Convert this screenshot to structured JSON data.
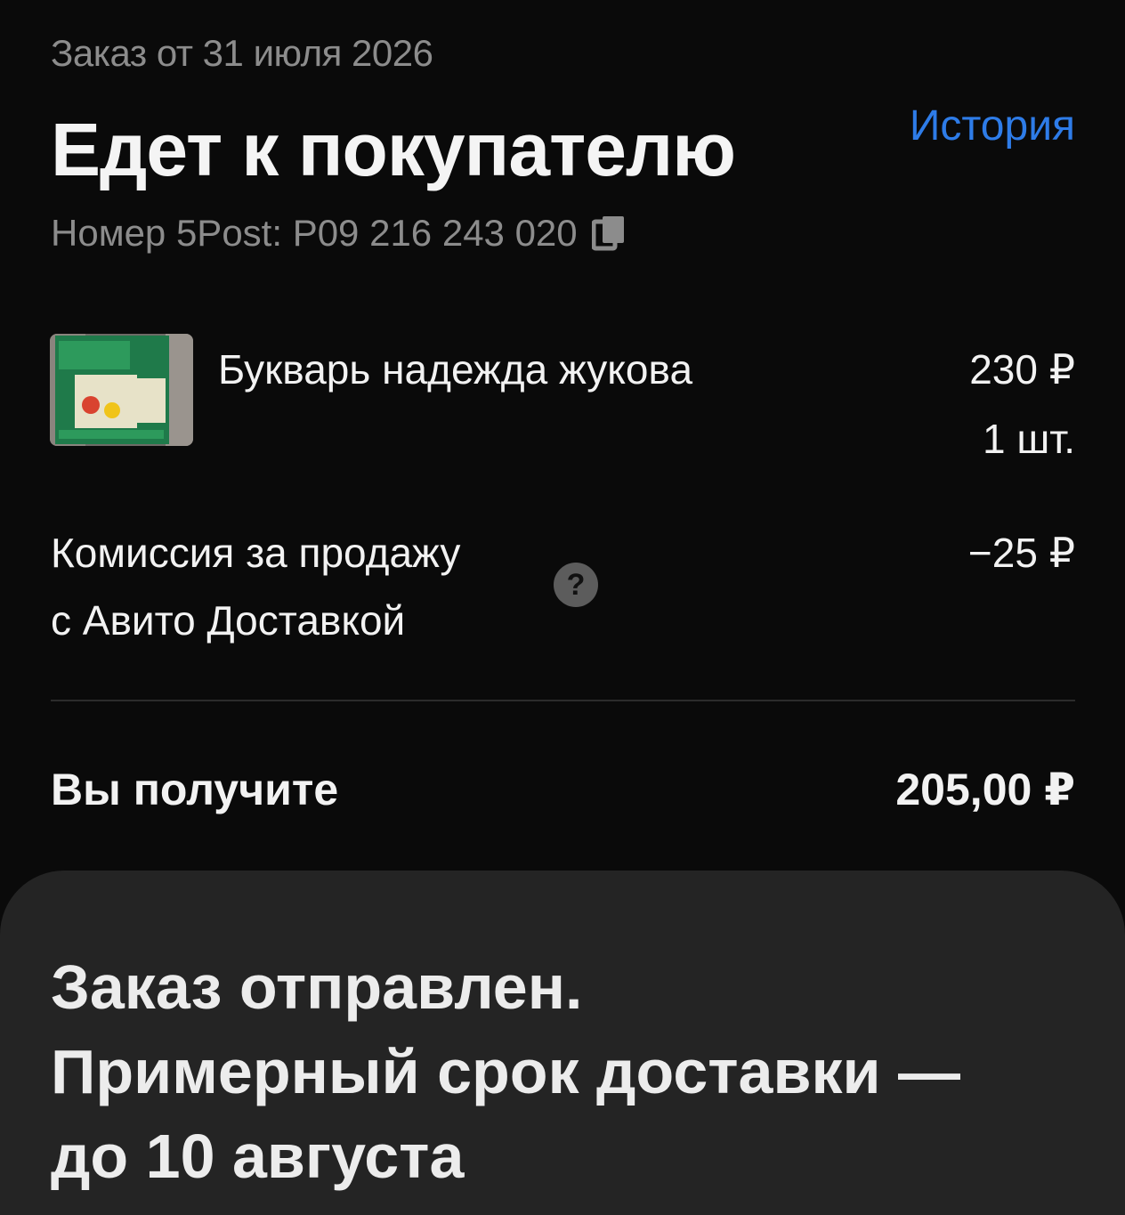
{
  "order": {
    "date_label": "Заказ от 31 июля 2026",
    "status_title": "Едет к покупателю",
    "history_link": "История",
    "tracking_label": "Номер 5Post: P09 216 243 020"
  },
  "item": {
    "thumbnail_icon": "book-cover-image",
    "name": "Букварь надежда жукова",
    "price": "230 ₽",
    "quantity": "1 шт."
  },
  "fee": {
    "label_line1": "Комиссия за продажу",
    "label_line2": "с Авито Доставкой",
    "help_glyph": "?",
    "amount": "−25 ₽"
  },
  "payout": {
    "label": "Вы получите",
    "amount": "205,00 ₽"
  },
  "notice": {
    "line1": "Заказ отправлен.",
    "line2": "Примерный срок доставки —",
    "line3": "до 10 августа"
  },
  "colors": {
    "background": "#0a0a0a",
    "link": "#2e7ce8",
    "muted": "#8c8c8c",
    "sheet": "#242424"
  }
}
